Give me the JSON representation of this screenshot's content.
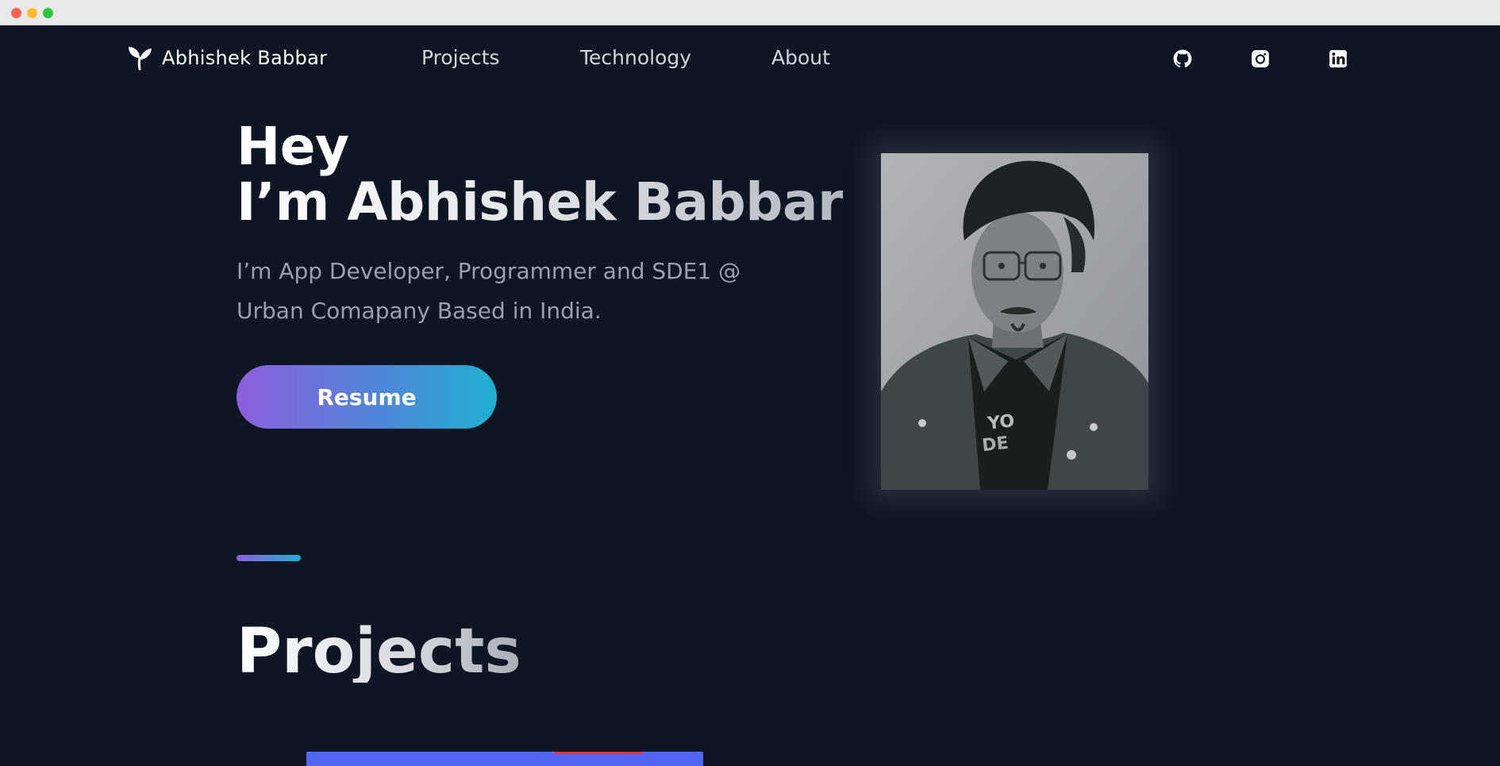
{
  "window": {
    "controls": [
      "close",
      "minimize",
      "zoom"
    ]
  },
  "nav": {
    "brand": {
      "name": "Abhishek Babbar",
      "logo_icon": "leaf-logo-icon"
    },
    "links": [
      {
        "label": "Projects"
      },
      {
        "label": "Technology"
      },
      {
        "label": "About"
      }
    ],
    "social": [
      {
        "icon": "github-icon"
      },
      {
        "icon": "instagram-icon"
      },
      {
        "icon": "linkedin-icon"
      }
    ]
  },
  "hero": {
    "greeting": "Hey",
    "headline": "I’m Abhishek Babbar",
    "description": "I’m App Developer, Programmer and SDE1 @ Urban Comapany Based in India.",
    "cta_label": "Resume",
    "photo_subject": "profile-photo"
  },
  "projects": {
    "title": "Projects"
  },
  "colors": {
    "background": "#0f1623",
    "accent_start": "#8e5ee0",
    "accent_end": "#1fb0d0",
    "project_card": "#5268f5"
  }
}
